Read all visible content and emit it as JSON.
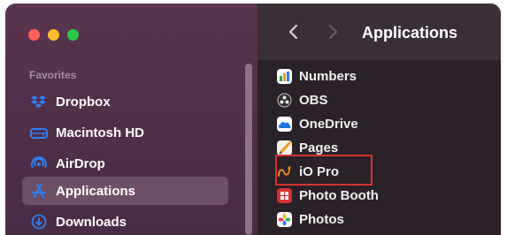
{
  "window": {
    "traffic_lights": [
      "close",
      "minimize",
      "zoom"
    ]
  },
  "sidebar": {
    "section_title": "Favorites",
    "items": [
      {
        "label": "Dropbox",
        "icon": "dropbox-icon"
      },
      {
        "label": "Macintosh HD",
        "icon": "hard-drive-icon"
      },
      {
        "label": "AirDrop",
        "icon": "airdrop-icon"
      },
      {
        "label": "Applications",
        "icon": "applications-icon",
        "selected": true
      },
      {
        "label": "Downloads",
        "icon": "downloads-icon"
      }
    ]
  },
  "toolbar": {
    "title": "Applications",
    "back_icon": "chevron-left-icon",
    "forward_icon": "chevron-right-icon"
  },
  "files": [
    {
      "name": "Numbers",
      "icon": "numbers-app-icon"
    },
    {
      "name": "OBS",
      "icon": "obs-app-icon"
    },
    {
      "name": "OneDrive",
      "icon": "onedrive-app-icon"
    },
    {
      "name": "Pages",
      "icon": "pages-app-icon"
    },
    {
      "name": "iO Pro",
      "icon": "io-pro-app-icon",
      "highlighted": true
    },
    {
      "name": "Photo Booth",
      "icon": "photo-booth-app-icon"
    },
    {
      "name": "Photos",
      "icon": "photos-app-icon"
    }
  ],
  "colors": {
    "accent_highlight": "#d6332c",
    "sidebar_bg": "#523049",
    "selected_bg": "#6d5067"
  }
}
